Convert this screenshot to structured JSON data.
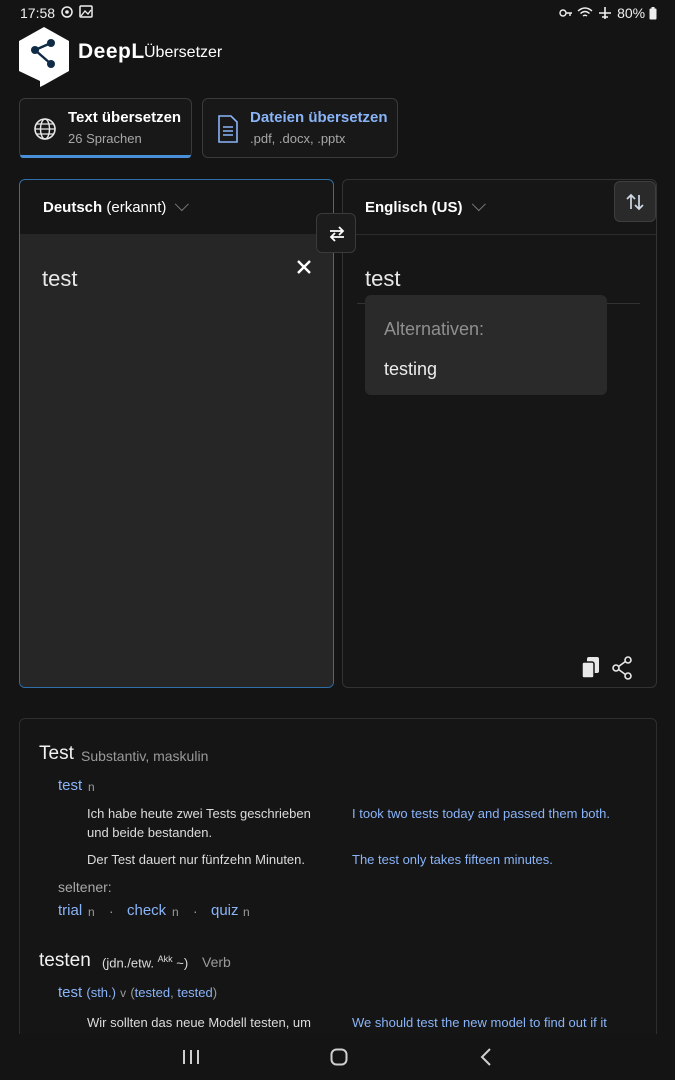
{
  "status": {
    "time": "17:58",
    "battery": "80%"
  },
  "header": {
    "brand": "DeepL",
    "subtitle": "Übersetzer"
  },
  "tabs": [
    {
      "title": "Text übersetzen",
      "sub": "26 Sprachen"
    },
    {
      "title": "Dateien übersetzen",
      "sub": ".pdf, .docx, .pptx"
    }
  ],
  "source": {
    "lang": "Deutsch",
    "detected": "(erkannt)",
    "text": "test"
  },
  "target": {
    "lang": "Englisch (US)",
    "text": "test"
  },
  "alternatives": {
    "title": "Alternativen:",
    "items": [
      "testing"
    ]
  },
  "dictionary": {
    "entry1": {
      "headword": "Test",
      "grammar": "Substantiv, maskulin",
      "translation": "test",
      "pos": "n",
      "examples": [
        {
          "de": "Ich habe heute zwei Tests geschrieben und beide bestanden.",
          "en": "I took two tests today and passed them both."
        },
        {
          "de": "Der Test dauert nur fünfzehn Minuten.",
          "en": "The test only takes fifteen minutes."
        }
      ],
      "rare_label": "seltener:",
      "rare": [
        {
          "word": "trial",
          "pos": "n"
        },
        {
          "word": "check",
          "pos": "n"
        },
        {
          "word": "quiz",
          "pos": "n"
        }
      ]
    },
    "entry2": {
      "headword": "testen",
      "context": "(jdn./etw.",
      "case": "Akk",
      "context_end": "~)",
      "grammar": "Verb",
      "translation": "test",
      "obj": "(sth.)",
      "pos": "v",
      "forms_open": "(",
      "form1": "tested",
      "form2": "tested",
      "forms_close": ")",
      "example": {
        "de": "Wir sollten das neue Modell testen, um",
        "en": "We should test the new model to find out if it"
      }
    }
  },
  "colors": {
    "accent": "#4a90d9",
    "link": "#8ab4f8",
    "background": "#141414"
  }
}
